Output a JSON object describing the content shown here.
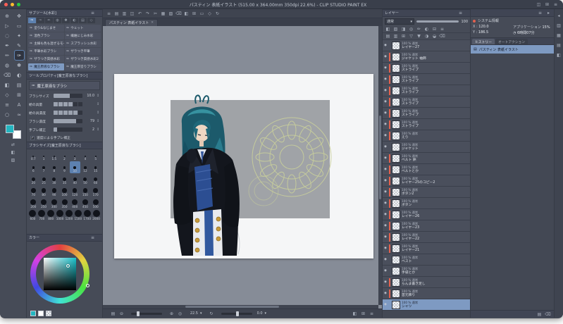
{
  "titlebar": {
    "title": "パスティン 表紙イラスト (515.00 x 364.00mm 350dpi 22.6%) - CLIP STUDIO PAINT EX",
    "icons": [
      {
        "name": "workspace-icon",
        "glyph": "◫"
      },
      {
        "name": "layout-icon",
        "glyph": "⊞"
      },
      {
        "name": "menu-icon",
        "glyph": "≡"
      }
    ]
  },
  "ui": {
    "check": "✓",
    "stepper": "↕",
    "dropdown": "▾",
    "close": "✕",
    "eye": "◉",
    "brush": "✑",
    "doc": "▤",
    "clock": "◔",
    "crosshair": "⊕"
  },
  "colors": {
    "accent": "#7e9ac2",
    "clip_marker": "#e2604d",
    "foreground_color": "#23b5c0",
    "background_color": "#ffffff"
  },
  "tool_strip": {
    "icons": [
      {
        "name": "zoom-tool-icon",
        "glyph": "⊕"
      },
      {
        "name": "move-tool-icon",
        "glyph": "✥"
      },
      {
        "name": "operation-tool-icon",
        "glyph": "▷"
      },
      {
        "name": "selection-tool-icon",
        "glyph": "▭"
      },
      {
        "name": "lasso-tool-icon",
        "glyph": "◌"
      },
      {
        "name": "autoselect-tool-icon",
        "glyph": "✦"
      },
      {
        "name": "eyedropper-tool-icon",
        "glyph": "✒"
      },
      {
        "name": "pen-tool-icon",
        "glyph": "✎"
      },
      {
        "name": "pencil-tool-icon",
        "glyph": "✏"
      },
      {
        "name": "brush-tool-icon",
        "glyph": "✑",
        "active": true
      },
      {
        "name": "airbrush-tool-icon",
        "glyph": "◍"
      },
      {
        "name": "decoration-tool-icon",
        "glyph": "✽"
      },
      {
        "name": "eraser-tool-icon",
        "glyph": "⌫"
      },
      {
        "name": "blend-tool-icon",
        "glyph": "◐"
      },
      {
        "name": "fill-tool-icon",
        "glyph": "◧"
      },
      {
        "name": "gradient-tool-icon",
        "glyph": "▤"
      },
      {
        "name": "figure-tool-icon",
        "glyph": "◇"
      },
      {
        "name": "frame-tool-icon",
        "glyph": "⊞"
      },
      {
        "name": "ruler-tool-icon",
        "glyph": "≡"
      },
      {
        "name": "text-tool-icon",
        "glyph": "A"
      },
      {
        "name": "balloon-tool-icon",
        "glyph": "○"
      },
      {
        "name": "correction-tool-icon",
        "glyph": "≈"
      }
    ],
    "bottom_icons": [
      {
        "name": "switch-colors-icon",
        "glyph": "⇄"
      },
      {
        "name": "default-colors-icon",
        "glyph": "◧"
      },
      {
        "name": "transparent-color-icon",
        "glyph": "▨"
      }
    ]
  },
  "subtool": {
    "header": "サブツール[水彩]",
    "header_icons": [
      {
        "name": "panel-menu-icon",
        "glyph": "≡"
      }
    ],
    "tabs": [
      {
        "name": "subtool-tab-1",
        "glyph": "✑",
        "active": true
      },
      {
        "name": "subtool-tab-2",
        "glyph": "✑"
      },
      {
        "name": "subtool-tab-3",
        "glyph": "✏"
      },
      {
        "name": "subtool-tab-4",
        "glyph": "◍"
      },
      {
        "name": "subtool-tab-5",
        "glyph": "✽"
      },
      {
        "name": "subtool-tab-6",
        "glyph": "◐"
      },
      {
        "name": "subtool-tab-7",
        "glyph": "▤"
      },
      {
        "name": "subtool-tab-8",
        "glyph": "◇"
      }
    ],
    "brushes": [
      {
        "label": "塗り&なじませ"
      },
      {
        "label": "ウェット"
      },
      {
        "label": "混色ブラシ"
      },
      {
        "label": "繊維にじみ水彩"
      },
      {
        "label": "主線も色も混ぜるモード"
      },
      {
        "label": "スプラッシュ水彩"
      },
      {
        "label": "平筆水彩ブラシ"
      },
      {
        "label": "ザラつき平筆"
      },
      {
        "label": "ザラつき質感水彩"
      },
      {
        "label": "ザラつき質感水彩2"
      },
      {
        "label": "魔王原液なブラシ",
        "selected": true
      },
      {
        "label": "魔王厚塗りブラシ"
      }
    ]
  },
  "tool_property": {
    "header": "ツールプロパティ[魔王原液なブラシ]",
    "brush_name": "魔王原液なブラシ",
    "sliders": [
      {
        "label": "ブラシサイズ",
        "kind": "bar",
        "value": "10.0",
        "fill": 55
      },
      {
        "label": "絵の具量",
        "kind": "seg",
        "filled": 4,
        "total": 6
      },
      {
        "label": "絵の具濃度",
        "kind": "seg",
        "filled": 5,
        "total": 6
      },
      {
        "label": "ブラシ濃度",
        "kind": "bar",
        "value": "79",
        "fill": 79
      },
      {
        "label": "手ブレ補正",
        "kind": "bar",
        "value": "2",
        "fill": 12
      }
    ],
    "checkbox": {
      "label": "速度による手ブレ補正",
      "checked": true
    }
  },
  "brush_size_panel": {
    "header": "ブラシサイズ[魔王原液なブラシ]",
    "selected": "10",
    "rows": [
      [
        "0.7",
        "1",
        "1.5",
        "2",
        "3",
        "4",
        "5"
      ],
      [
        "6",
        "7",
        "8",
        "9",
        "10",
        "12",
        "15"
      ],
      [
        "20",
        "25",
        "30",
        "35",
        "40",
        "50",
        "60"
      ],
      [
        "70",
        "80",
        "90",
        "100",
        "120",
        "150",
        "170"
      ],
      [
        "200",
        "250",
        "300",
        "350",
        "400",
        "450",
        "500"
      ],
      [
        "600",
        "700",
        "800",
        "1000",
        "1200",
        "1500",
        "1700",
        "2000"
      ]
    ]
  },
  "color_panel": {
    "header": "カラー",
    "header_icons": [
      {
        "name": "panel-menu-icon",
        "glyph": "≡"
      }
    ],
    "selected_color": "#23b5c0"
  },
  "canvas": {
    "tab": "パスティン 表紙イラスト",
    "toolbar_icons": [
      {
        "name": "menu-icon",
        "glyph": "≡"
      },
      {
        "name": "new-file-icon",
        "glyph": "▤"
      },
      {
        "name": "open-file-icon",
        "glyph": "▥"
      },
      {
        "name": "save-icon",
        "glyph": "◫"
      },
      {
        "name": "undo-icon",
        "glyph": "↶"
      },
      {
        "name": "redo-icon",
        "glyph": "↷"
      },
      {
        "name": "cut-icon",
        "glyph": "✂"
      },
      {
        "name": "copy-icon",
        "glyph": "▦"
      },
      {
        "name": "paste-icon",
        "glyph": "▧"
      },
      {
        "name": "delete-icon",
        "glyph": "⌫"
      },
      {
        "name": "fill-icon",
        "glyph": "◧"
      },
      {
        "name": "grid-icon",
        "glyph": "⊞"
      },
      {
        "name": "selection-launcher-icon",
        "glyph": "▭"
      },
      {
        "name": "snap-icon",
        "glyph": "◇"
      },
      {
        "name": "rotate-view-icon",
        "glyph": "↻"
      }
    ],
    "status": {
      "zoom": "22.5",
      "rotation": "0.0",
      "left_icons": [
        {
          "name": "fit-screen-icon",
          "glyph": "▤"
        },
        {
          "name": "zoom-out-icon",
          "glyph": "⊖"
        }
      ],
      "mid_icons": [
        {
          "name": "zoom-in-icon",
          "glyph": "⊕"
        },
        {
          "name": "reset-zoom-icon",
          "glyph": "◎"
        }
      ],
      "rot_icons": [
        {
          "name": "rotate-reset-icon",
          "glyph": "↻"
        }
      ],
      "right_icons": [
        {
          "name": "flip-icon",
          "glyph": "◧"
        },
        {
          "name": "pixel-grid-icon",
          "glyph": "⊞"
        },
        {
          "name": "panel-menu-icon",
          "glyph": "≡"
        }
      ]
    }
  },
  "layers_panel": {
    "header": "レイヤー",
    "header_icons": [
      {
        "name": "panel-menu-icon",
        "glyph": "≡"
      }
    ],
    "blend_mode": "通常",
    "opacity": "100",
    "icon_row1": [
      {
        "name": "lock-layer-icon",
        "glyph": "◧"
      },
      {
        "name": "lock-alpha-icon",
        "glyph": "▨"
      },
      {
        "name": "clip-below-icon",
        "glyph": "◨"
      },
      {
        "name": "reference-layer-icon",
        "glyph": "◎"
      },
      {
        "name": "draft-layer-icon",
        "glyph": "✏"
      },
      {
        "name": "layer-color-icon",
        "glyph": "◐"
      },
      {
        "name": "two-pane-icon",
        "glyph": "⊟"
      },
      {
        "name": "palette-opt-icon",
        "glyph": "≡"
      }
    ],
    "icon_row2": [
      {
        "name": "new-layer-icon",
        "glyph": "▤"
      },
      {
        "name": "new-vector-layer-icon",
        "glyph": "▥"
      },
      {
        "name": "new-folder-icon",
        "glyph": "⊞"
      },
      {
        "name": "transfer-down-icon",
        "glyph": "▽"
      },
      {
        "name": "merge-down-icon",
        "glyph": "▼"
      },
      {
        "name": "mask-icon",
        "glyph": "◑"
      },
      {
        "name": "apply-mask-icon",
        "glyph": "◒"
      },
      {
        "name": "delete-layer-icon",
        "glyph": "⌫"
      }
    ],
    "layers": [
      {
        "opacity": "100",
        "blend": "通常",
        "name": "レイヤー27",
        "clip": false
      },
      {
        "opacity": "100",
        "blend": "通常",
        "name": "ジャケット 袖飾",
        "clip": true
      },
      {
        "opacity": "100",
        "blend": "通常",
        "name": "ストライプ",
        "clip": true
      },
      {
        "opacity": "100",
        "blend": "通常",
        "name": "ストライプ",
        "clip": true
      },
      {
        "opacity": "100",
        "blend": "通常",
        "name": "ストライプ",
        "clip": true
      },
      {
        "opacity": "100",
        "blend": "通常",
        "name": "ストライプ",
        "clip": true
      },
      {
        "opacity": "100",
        "blend": "通常",
        "name": "ストライプ",
        "clip": true
      },
      {
        "opacity": "100",
        "blend": "通常",
        "name": "ストライプ",
        "clip": true
      },
      {
        "opacity": "100",
        "blend": "通常",
        "name": "えり",
        "clip": true
      },
      {
        "opacity": "100",
        "blend": "通常",
        "name": "ジャケット",
        "clip": false
      },
      {
        "opacity": "100",
        "blend": "通常",
        "name": "ベルト 鋲",
        "clip": true
      },
      {
        "opacity": "100",
        "blend": "通常",
        "name": "ベルトとか",
        "clip": true
      },
      {
        "opacity": "100",
        "blend": "通常",
        "name": "レイヤー25のコピー2",
        "clip": true
      },
      {
        "opacity": "100",
        "blend": "通常",
        "name": "ボタン2",
        "clip": true
      },
      {
        "opacity": "100",
        "blend": "通常",
        "name": "ボタン",
        "clip": true
      },
      {
        "opacity": "100",
        "blend": "通常",
        "name": "レイヤー26",
        "clip": true
      },
      {
        "opacity": "100",
        "blend": "通常",
        "name": "レイヤー23",
        "clip": true
      },
      {
        "opacity": "100",
        "blend": "通常",
        "name": "レイヤー22",
        "clip": true
      },
      {
        "opacity": "100",
        "blend": "通常",
        "name": "レイヤー21",
        "clip": true
      },
      {
        "opacity": "100",
        "blend": "通常",
        "name": "ベスト",
        "clip": false
      },
      {
        "opacity": "100",
        "blend": "通常",
        "name": "手袋とか",
        "clip": false
      },
      {
        "opacity": "100",
        "blend": "通常",
        "name": "らんま書き足し",
        "clip": true
      },
      {
        "opacity": "100",
        "blend": "通常",
        "name": "首元飾り",
        "clip": true
      },
      {
        "opacity": "100",
        "blend": "通常",
        "name": "シャツ",
        "clip": false,
        "selected": true
      }
    ]
  },
  "info_panel": {
    "top_icons": [
      {
        "name": "panel-menu-icon",
        "glyph": "≡"
      },
      {
        "name": "collapse-icon",
        "glyph": "▸"
      }
    ],
    "system_label": "システム情報",
    "app_label": "アプリケーション",
    "app_value": "15%",
    "x_label": "X :",
    "x_value": "120.0",
    "y_label": "Y :",
    "y_value": "186.5",
    "time_value": "6時間07分"
  },
  "history_panel": {
    "tab": "ヒストリー",
    "tab2": "オートアクション",
    "items": [
      {
        "name": "パスティン 表紙イラスト",
        "selected": true
      }
    ],
    "bottom_icons": [
      {
        "name": "snapshot-icon",
        "glyph": "▤"
      },
      {
        "name": "delete-history-icon",
        "glyph": "⌫"
      }
    ]
  },
  "edge_strip": {
    "icons": [
      {
        "name": "collapse-panels-icon",
        "glyph": "◂"
      },
      {
        "name": "navigator-panel-icon",
        "glyph": "▥"
      },
      {
        "name": "subview-panel-icon",
        "glyph": "▦"
      },
      {
        "name": "item-bank-panel-icon",
        "glyph": "▤"
      },
      {
        "name": "material-panel-icon",
        "glyph": "◧"
      }
    ]
  }
}
